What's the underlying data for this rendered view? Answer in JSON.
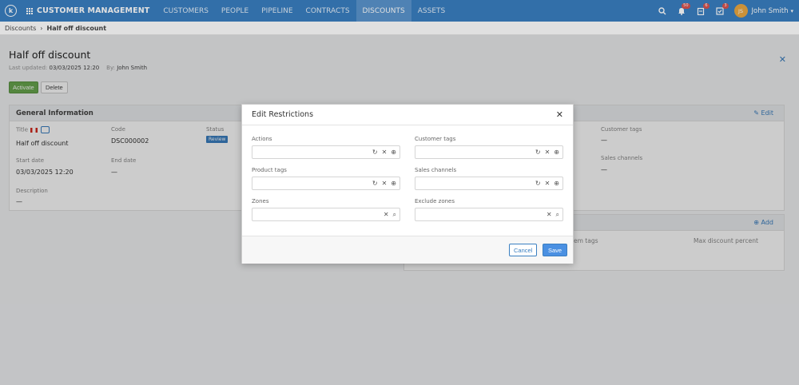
{
  "topbar": {
    "app_title": "CUSTOMER MANAGEMENT",
    "nav": [
      "CUSTOMERS",
      "PEOPLE",
      "PIPELINE",
      "CONTRACTS",
      "DISCOUNTS",
      "ASSETS"
    ],
    "active_nav": "DISCOUNTS",
    "notifications_count": "50",
    "tasks_count": "6",
    "approvals_count": "3",
    "avatar_initials": "JS",
    "user_name": "John Smith"
  },
  "breadcrumb": {
    "parent": "Discounts",
    "current": "Half off discount"
  },
  "page": {
    "title": "Half off discount",
    "last_updated_label": "Last updated:",
    "last_updated_value": "03/03/2025 12:20",
    "by_label": "By:",
    "by_value": "John Smith",
    "activate_label": "Activate",
    "delete_label": "Delete"
  },
  "general_info": {
    "heading": "General Information",
    "title_label": "Title",
    "title_value": "Half off discount",
    "code_label": "Code",
    "code_value": "DSC000002",
    "status_label": "Status",
    "status_value": "Review",
    "start_date_label": "Start date",
    "start_date_value": "03/03/2025 12:20",
    "end_date_label": "End date",
    "end_date_value": "—",
    "description_label": "Description",
    "description_value": "—"
  },
  "restrictions_panel": {
    "edit_label": "Edit",
    "customer_tags_label": "Customer tags",
    "customer_tags_value": "—",
    "sales_channels_label": "Sales channels",
    "sales_channels_value": "—"
  },
  "tiers_panel": {
    "add_label": "Add",
    "col_item_tags": "Item tags",
    "col_item_tags_visible": "em tags",
    "col_max_discount": "Max discount percent"
  },
  "modal": {
    "title": "Edit Restrictions",
    "fields": {
      "actions": "Actions",
      "customer_tags": "Customer tags",
      "product_tags": "Product tags",
      "sales_channels": "Sales channels",
      "zones": "Zones",
      "exclude_zones": "Exclude zones"
    },
    "cancel_label": "Cancel",
    "save_label": "Save"
  },
  "colors": {
    "topbar": "#3a7fc1",
    "accent": "#4a90e2",
    "success": "#6aa84f",
    "badge": "#d9534f"
  }
}
